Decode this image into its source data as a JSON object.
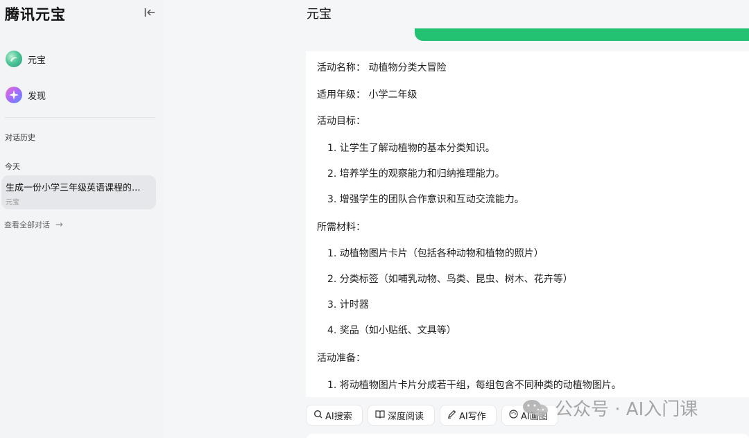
{
  "sidebar": {
    "brand": "腾讯元宝",
    "nav": [
      {
        "label": "元宝",
        "icon": "yuanbao-logo-icon"
      },
      {
        "label": "发现",
        "icon": "sparkle-icon"
      }
    ],
    "history_label": "对话历史",
    "today_label": "今天",
    "history_items": [
      {
        "title": "生成一份小学三年级英语课程的...",
        "subtitle": "元宝"
      }
    ],
    "view_all": "查看全部对话"
  },
  "main": {
    "title": "元宝",
    "lines": [
      "活动名称：  动植物分类大冒险",
      "适用年级：  小学二年级",
      "活动目标：",
      "1. 让学生了解动植物的基本分类知识。",
      "2. 培养学生的观察能力和归纳推理能力。",
      "3. 增强学生的团队合作意识和互动交流能力。",
      "所需材料：",
      "1. 动植物图片卡片（包括各种动物和植物的照片）",
      "2. 分类标签（如哺乳动物、鸟类、昆虫、树木、花卉等）",
      "3. 计时器",
      "4. 奖品（如小贴纸、文具等）",
      "活动准备：",
      "1. 将动植物图片卡片分成若干组，每组包含不同种类的动植物图片。"
    ]
  },
  "toolbar": {
    "buttons": [
      {
        "label": "AI搜索",
        "icon": "search-icon"
      },
      {
        "label": "深度阅读",
        "icon": "book-icon"
      },
      {
        "label": "AI写作",
        "icon": "pen-icon"
      },
      {
        "label": "AI画图",
        "icon": "palette-icon"
      }
    ]
  },
  "watermark": {
    "text": "公众号 · AI入门课"
  },
  "colors": {
    "accent_green": "#22c272",
    "sidebar_bg": "#f3f4f6",
    "selected_bg": "#e6e7ea"
  }
}
